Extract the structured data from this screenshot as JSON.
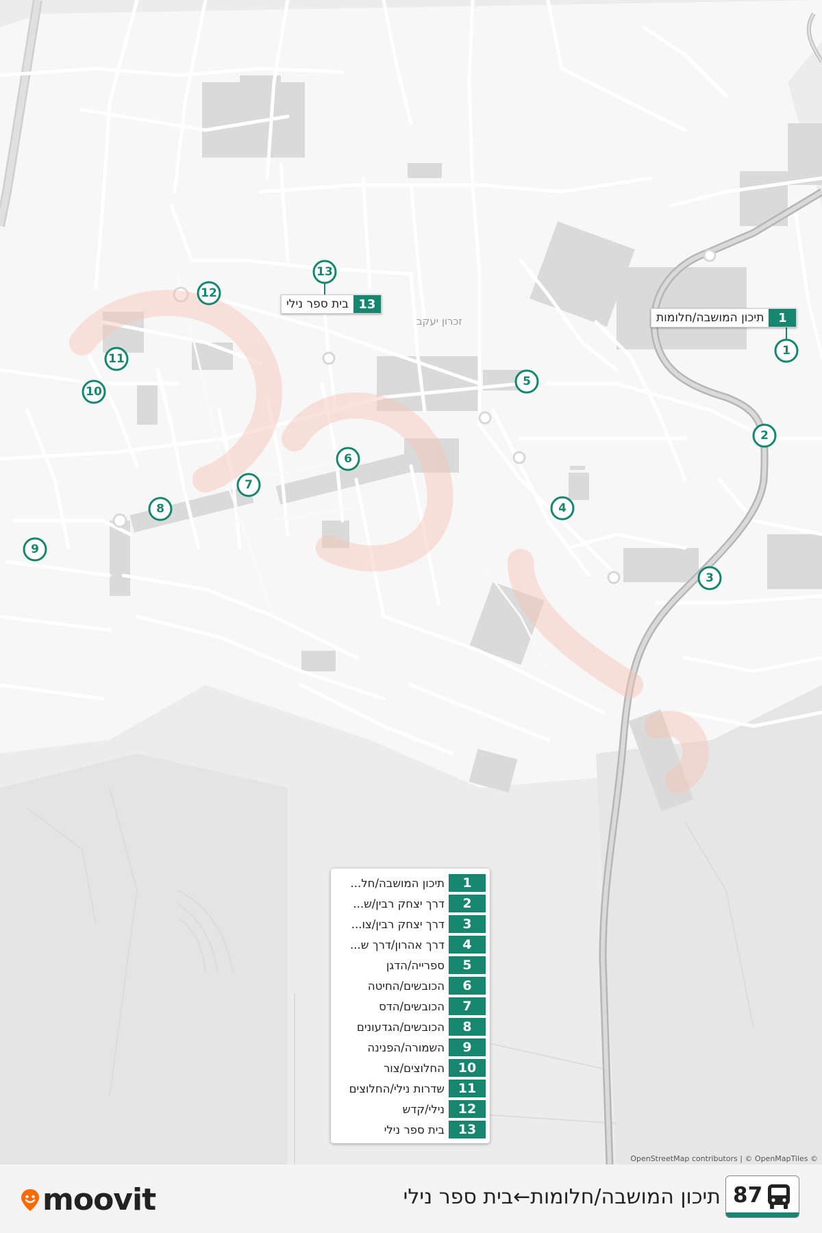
{
  "map": {
    "city_label": "זכרון יעקב",
    "attribution": "OpenStreetMap contributors | © OpenMapTiles ©",
    "callouts": [
      {
        "id": "1",
        "name": "תיכון המושבה/חלומות"
      },
      {
        "id": "13",
        "name": "בית ספר נילי"
      }
    ],
    "stops": [
      {
        "id": "1",
        "name": "תיכון המושבה/חל..."
      },
      {
        "id": "2",
        "name": "דרך יצחק רבין/ש..."
      },
      {
        "id": "3",
        "name": "דרך יצחק רבין/צו..."
      },
      {
        "id": "4",
        "name": "דרך אהרון/דרך ש..."
      },
      {
        "id": "5",
        "name": "ספרייה/הדגן"
      },
      {
        "id": "6",
        "name": "הכובשים/החיטה"
      },
      {
        "id": "7",
        "name": "הכובשים/הדס"
      },
      {
        "id": "8",
        "name": "הכובשים/הגדעונים"
      },
      {
        "id": "9",
        "name": "השמורה/הפנינה"
      },
      {
        "id": "10",
        "name": "החלוצים/צור"
      },
      {
        "id": "11",
        "name": "שדרות נילי/החלוצים"
      },
      {
        "id": "12",
        "name": "נילי/קדש"
      },
      {
        "id": "13",
        "name": "בית ספר נילי"
      }
    ],
    "colors": {
      "route": "#16866f",
      "watermark": "#f6c9c0",
      "brand": "#ff6a00"
    }
  },
  "footer": {
    "logo_text": "moovit",
    "route_number": "87",
    "route_title": "תיכון המושבה/חלומות←בית ספר נילי",
    "bus_icon": "bus-icon"
  }
}
